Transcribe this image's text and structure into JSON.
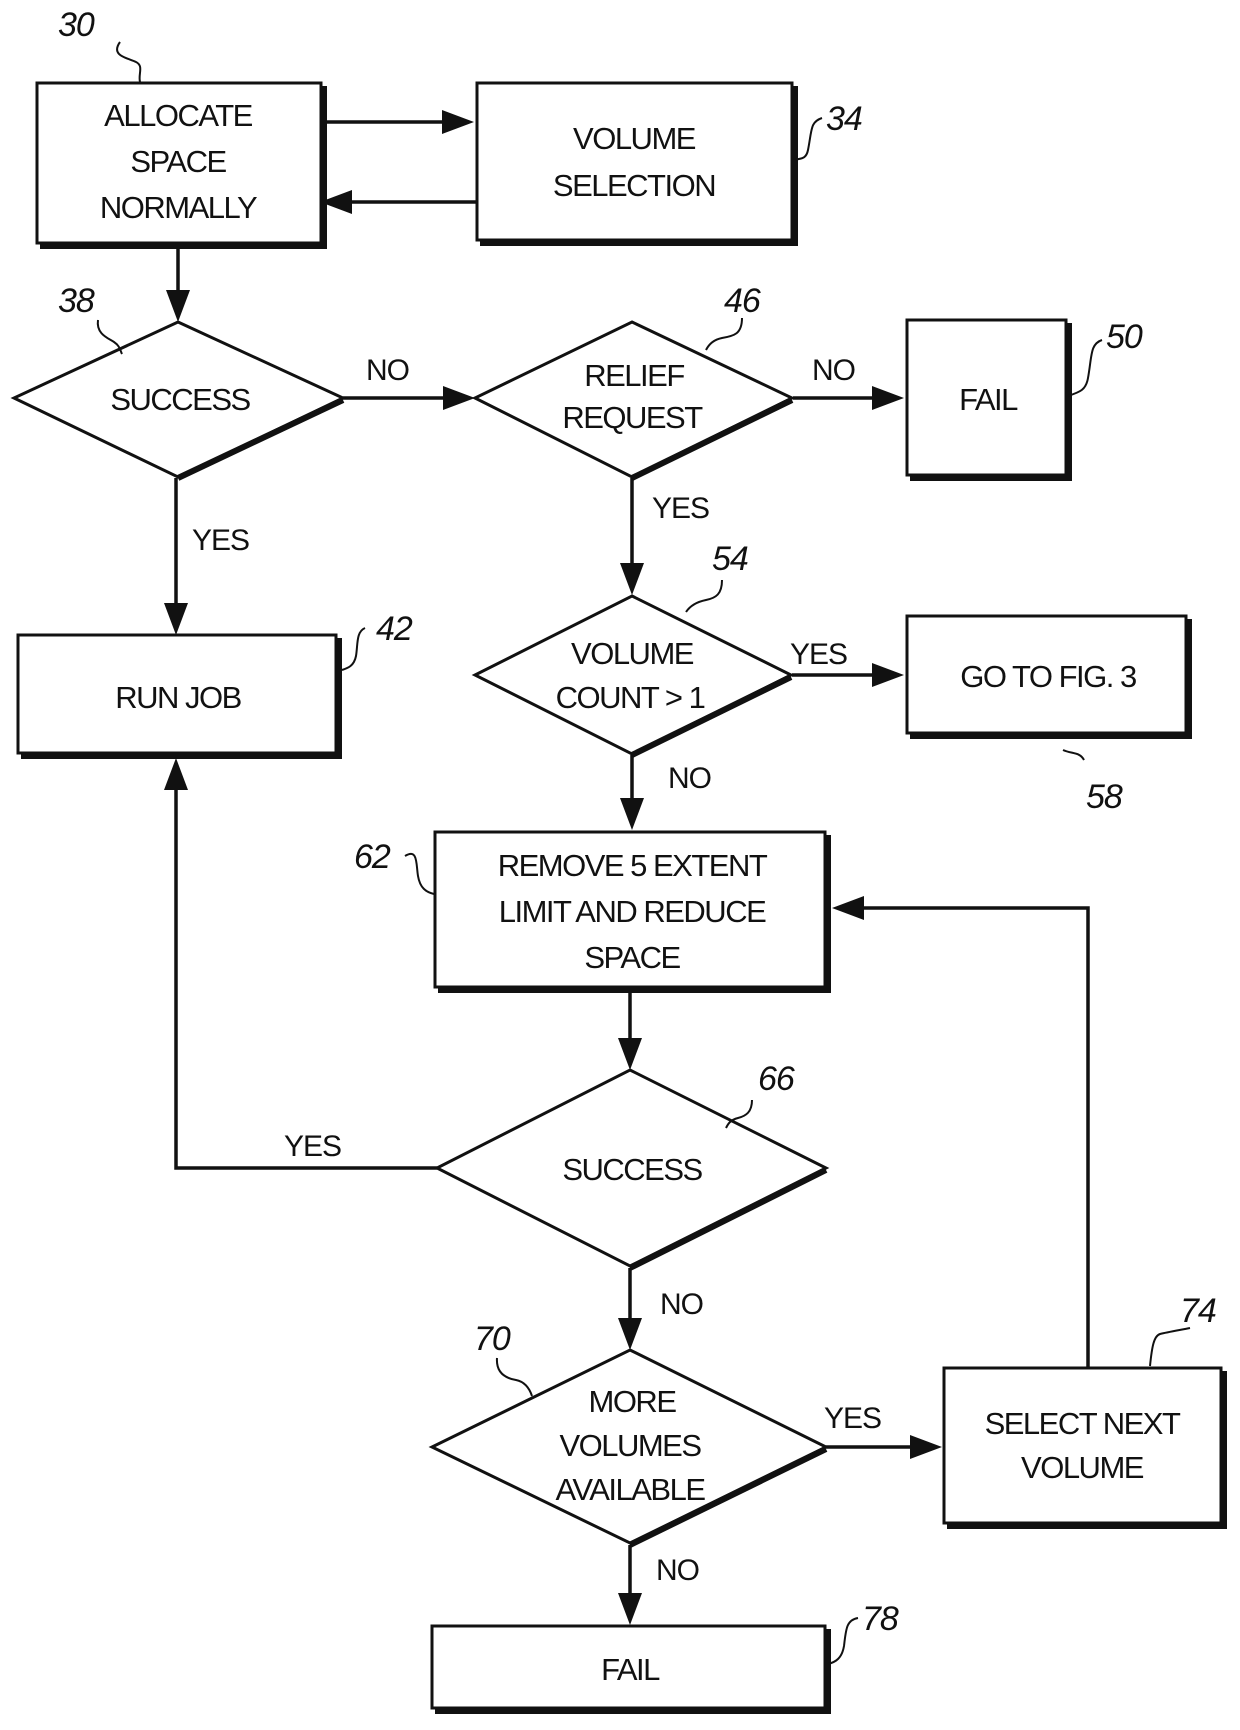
{
  "nodes": {
    "allocate": {
      "ref": "30",
      "lines": [
        "ALLOCATE",
        "SPACE",
        "NORMALLY"
      ]
    },
    "volume_selection": {
      "ref": "34",
      "lines": [
        "VOLUME",
        "SELECTION"
      ]
    },
    "success1": {
      "ref": "38",
      "lines": [
        "SUCCESS"
      ]
    },
    "run_job": {
      "ref": "42",
      "lines": [
        "RUN JOB"
      ]
    },
    "relief": {
      "ref": "46",
      "lines": [
        "RELIEF",
        "REQUEST"
      ]
    },
    "fail1": {
      "ref": "50",
      "lines": [
        "FAIL"
      ]
    },
    "volcount": {
      "ref": "54",
      "lines": [
        "VOLUME",
        "COUNT > 1"
      ]
    },
    "goto": {
      "ref": "58",
      "lines": [
        "GO TO FIG. 3"
      ]
    },
    "remove": {
      "ref": "62",
      "lines": [
        "REMOVE 5 EXTENT",
        "LIMIT AND REDUCE",
        "SPACE"
      ]
    },
    "success2": {
      "ref": "66",
      "lines": [
        "SUCCESS"
      ]
    },
    "more": {
      "ref": "70",
      "lines": [
        "MORE",
        "VOLUMES",
        "AVAILABLE"
      ]
    },
    "select_next": {
      "ref": "74",
      "lines": [
        "SELECT NEXT",
        "VOLUME"
      ]
    },
    "fail2": {
      "ref": "78",
      "lines": [
        "FAIL"
      ]
    }
  },
  "edges": {
    "success1_no": "NO",
    "success1_yes": "YES",
    "relief_no": "NO",
    "relief_yes": "YES",
    "volcount_yes": "YES",
    "volcount_no": "NO",
    "success2_yes": "YES",
    "success2_no": "NO",
    "more_yes": "YES",
    "more_no": "NO"
  }
}
